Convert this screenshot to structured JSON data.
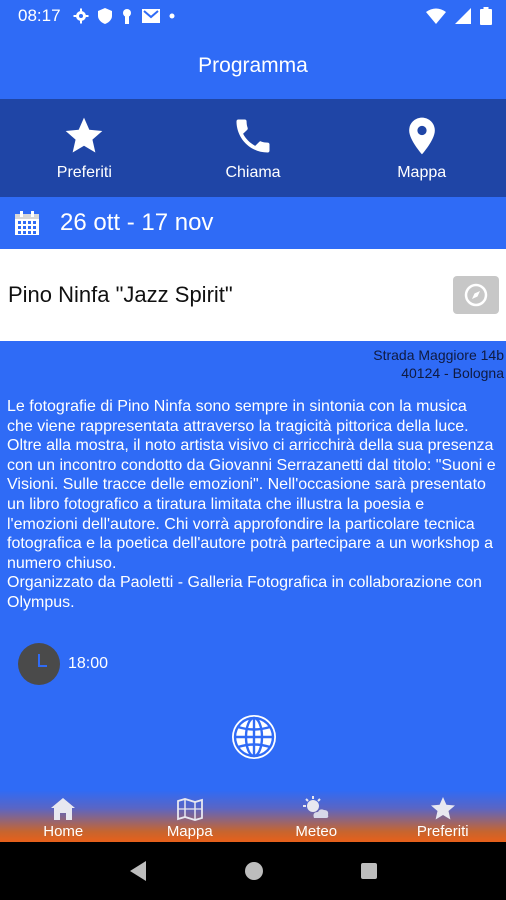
{
  "status_bar": {
    "time": "08:17"
  },
  "app_bar": {
    "title": "Programma"
  },
  "actions": [
    {
      "label": "Preferiti",
      "icon": "star-icon"
    },
    {
      "label": "Chiama",
      "icon": "phone-icon"
    },
    {
      "label": "Mappa",
      "icon": "map-pin-icon"
    }
  ],
  "event": {
    "date_range": "26 ott - 17 nov",
    "title": "Pino Ninfa \"Jazz Spirit\"",
    "address_line1": "Strada Maggiore 14b",
    "address_line2": "40124 - Bologna",
    "description": "Le fotografie di Pino Ninfa sono sempre in sintonia con la musica che viene rappresentata attraverso la tragicità pittorica della luce. Oltre alla mostra, il noto artista visivo ci arricchirà della sua presenza con un incontro condotto da Giovanni Serrazanetti dal titolo: \"Suoni e Visioni. Sulle tracce delle emozioni\". Nell'occasione sarà presentato un libro fotografico a tiratura limitata che illustra la poesia e l'emozioni dell'autore. Chi vorrà approfondire la particolare tecnica fotografica e la poetica dell'autore potrà partecipare a un workshop a numero chiuso.\nOrganizzato da Paoletti - Galleria Fotografica in collaborazione con Olympus.",
    "time": "18:00"
  },
  "bottom_nav": [
    {
      "label": "Home",
      "icon": "home-icon"
    },
    {
      "label": "Mappa",
      "icon": "map-icon"
    },
    {
      "label": "Meteo",
      "icon": "weather-icon"
    },
    {
      "label": "Preferiti",
      "icon": "star-icon"
    }
  ],
  "colors": {
    "primary": "#2f6bf6",
    "action_bar": "#1f45a6",
    "bottom_accent": "#e8601a"
  }
}
